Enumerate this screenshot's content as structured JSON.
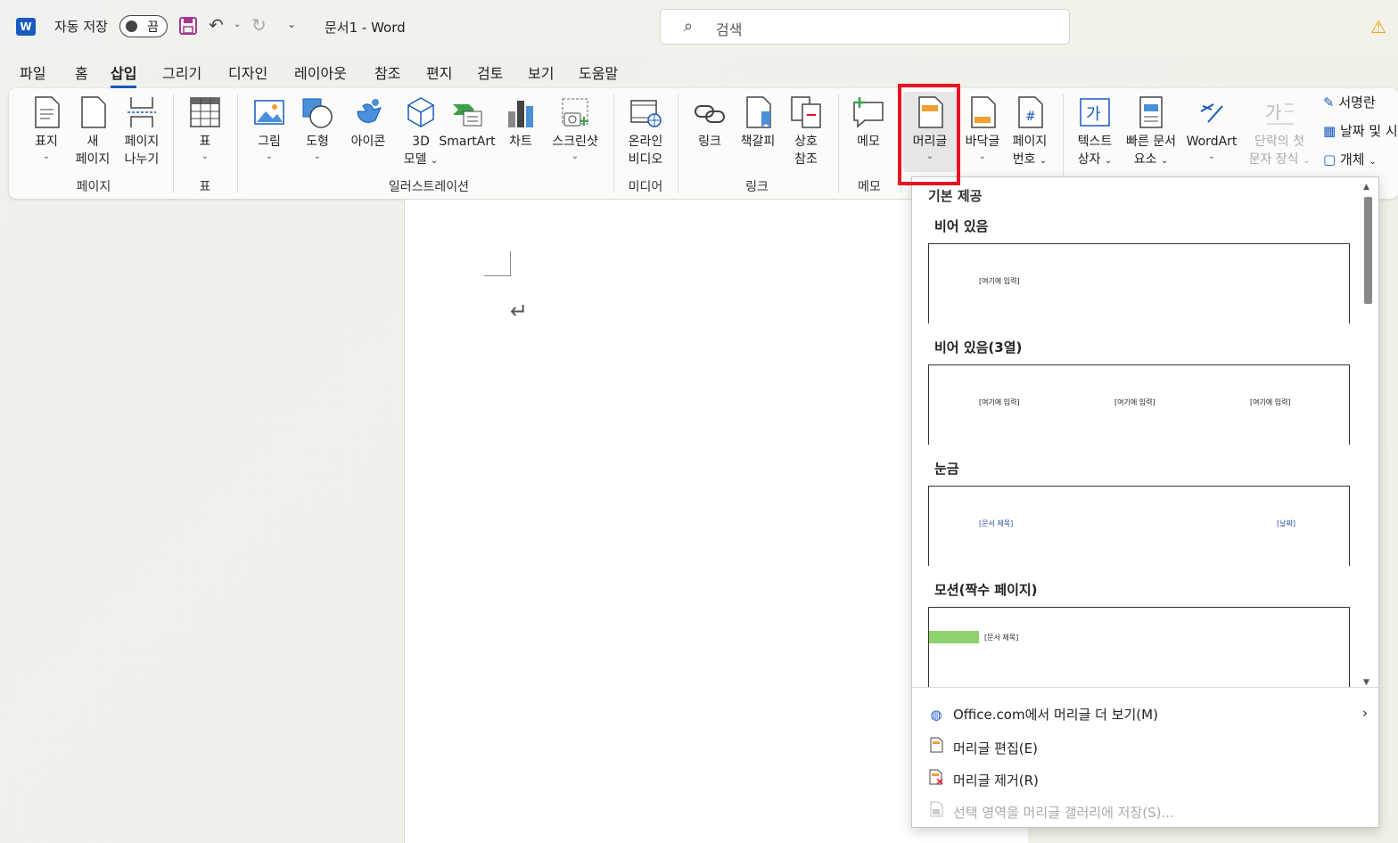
{
  "title_bar": {
    "logo_letter": "W",
    "autosave_label": "자동 저장",
    "autosave_state": "끔",
    "doc_title": "문서1  -  Word",
    "search_placeholder": "검색"
  },
  "tabs": [
    "파일",
    "홈",
    "삽입",
    "그리기",
    "디자인",
    "레이아웃",
    "참조",
    "편지",
    "검토",
    "보기",
    "도움말"
  ],
  "active_tab": "삽입",
  "ribbon": {
    "pages": {
      "group": "페이지",
      "cover": "표지",
      "blank_1": "새",
      "blank_2": "페이지",
      "break_1": "페이지",
      "break_2": "나누기"
    },
    "table": {
      "group": "표",
      "table": "표"
    },
    "illustrations": {
      "group": "일러스트레이션",
      "pictures": "그림",
      "shapes": "도형",
      "icons": "아이콘",
      "model3d_1": "3D",
      "model3d_2": "모델",
      "smartart": "SmartArt",
      "chart": "차트",
      "screenshot": "스크린샷"
    },
    "media": {
      "group": "미디어",
      "video_1": "온라인",
      "video_2": "비디오"
    },
    "links": {
      "group": "링크",
      "link": "링크",
      "bookmark": "책갈피",
      "xref_1": "상호",
      "xref_2": "참조"
    },
    "comments": {
      "group": "메모",
      "comment": "메모"
    },
    "header_footer": {
      "header": "머리글",
      "footer": "바닥글",
      "pagenum_1": "페이지",
      "pagenum_2": "번호"
    },
    "text": {
      "textbox_1": "텍스트",
      "textbox_2": "상자",
      "quickparts_1": "빠른 문서",
      "quickparts_2": "요소",
      "wordart": "WordArt",
      "dropcap_1": "단락의 첫",
      "dropcap_2": "문자 장식",
      "signature": "서명란",
      "datetime": "날짜 및 시",
      "object": "개체"
    }
  },
  "header_gallery": {
    "heading": "기본 제공",
    "items": [
      {
        "name": "비어 있음",
        "placeholders": [
          "[여기에 입력]"
        ]
      },
      {
        "name": "비어 있음(3열)",
        "placeholders": [
          "[여기에 입력]",
          "[여기에 입력]",
          "[여기에 입력]"
        ]
      },
      {
        "name": "눈금",
        "placeholders": [
          "[문서 제목]",
          "[날짜]"
        ]
      },
      {
        "name": "모션(짝수 페이지)",
        "placeholders": [
          "[문서 제목]"
        ]
      }
    ],
    "menu": [
      {
        "label": "Office.com에서 머리글 더 보기(M)",
        "enabled": true
      },
      {
        "label": "머리글 편집(E)",
        "enabled": true
      },
      {
        "label": "머리글 제거(R)",
        "enabled": true
      },
      {
        "label": "선택 영역을 머리글 갤러리에 저장(S)...",
        "enabled": false
      }
    ]
  },
  "colors": {
    "accent": "#185abd",
    "highlight": "#e81123",
    "motion_bar": "#8fd16c"
  }
}
